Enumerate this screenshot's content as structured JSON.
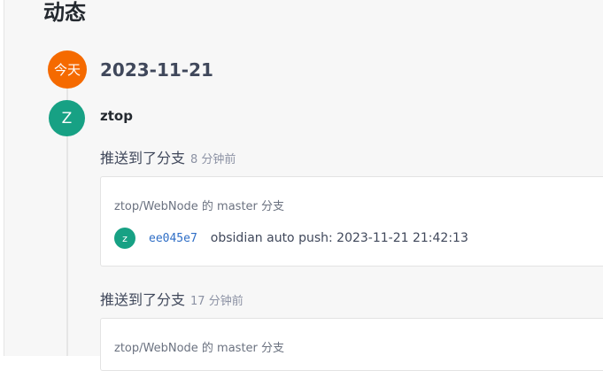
{
  "page": {
    "title": "动态"
  },
  "timeline": {
    "today_badge": "今天",
    "date": "2023-11-21",
    "user": {
      "avatar_letter": "Z",
      "name": "ztop"
    },
    "events": [
      {
        "title": "推送到了分支",
        "time": "8 分钟前",
        "branch_text": "ztop/WebNode 的 master 分支",
        "commits": [
          {
            "avatar_letter": "z",
            "hash": "ee045e7",
            "message": "obsidian auto push: 2023-11-21 21:42:13"
          }
        ]
      },
      {
        "title": "推送到了分支",
        "time": "17 分钟前",
        "branch_text": "ztop/WebNode 的 master 分支"
      }
    ]
  },
  "colors": {
    "today_badge": "#f56a00",
    "user_avatar": "#17a184",
    "commit_hash": "#2f6ec6"
  }
}
